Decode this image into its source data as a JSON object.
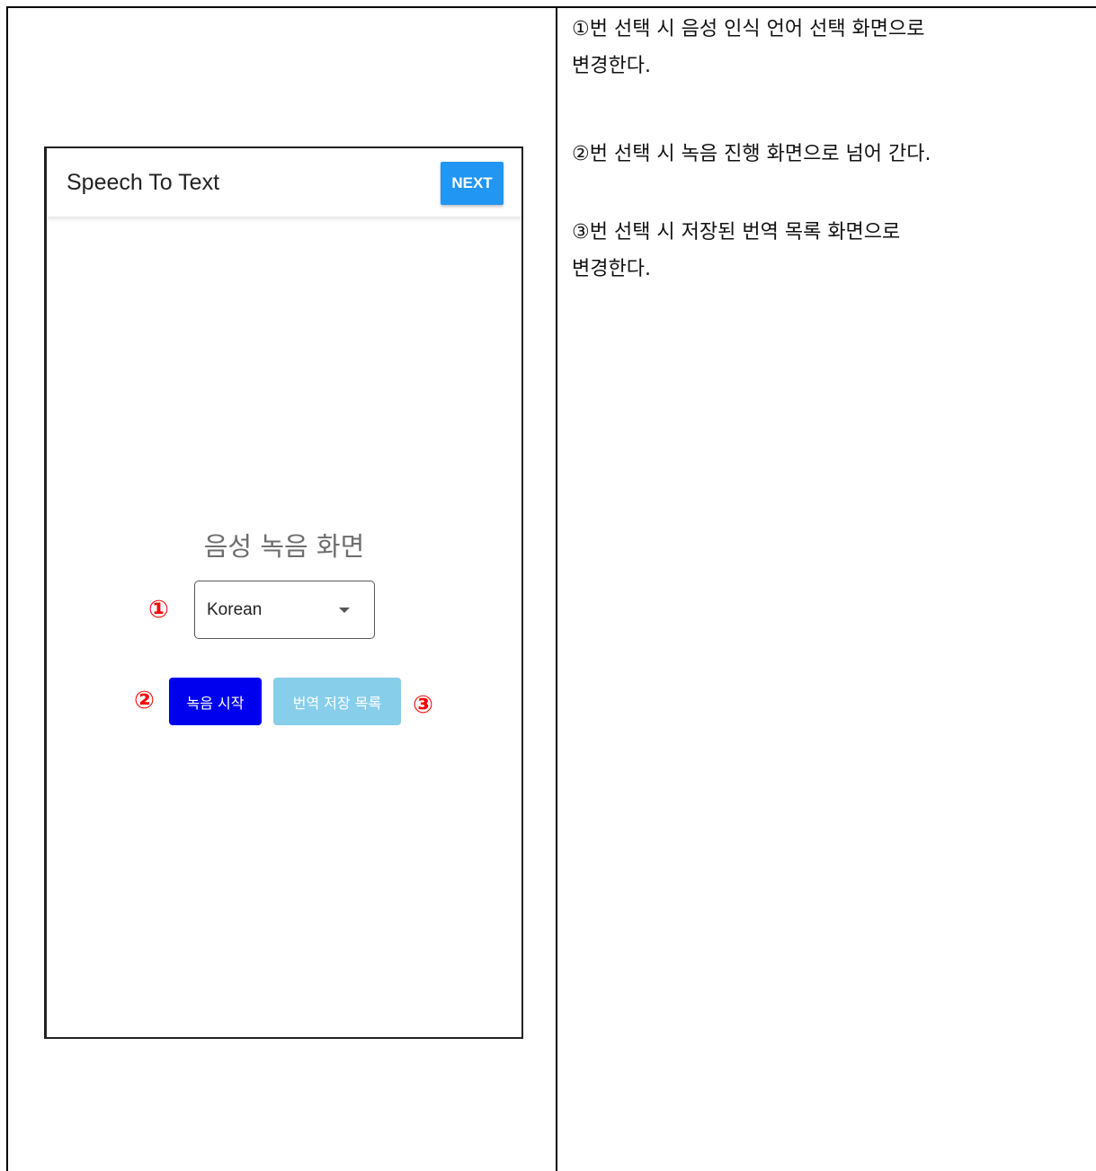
{
  "app": {
    "title": "Speech To Text",
    "next_label": "NEXT",
    "next_color": "#2196f3"
  },
  "screen": {
    "heading": "음성 녹음 화면",
    "language_select": {
      "value": "Korean"
    },
    "record_button_label": "녹음 시작",
    "record_button_color": "#0000ee",
    "saved_list_button_label": "번역 저장 목록",
    "saved_list_button_color": "#87ceeb"
  },
  "markers": [
    "①",
    "②",
    "③"
  ],
  "marker_color": "#ff0000",
  "descriptions": [
    {
      "lines": [
        "①번 선택 시 음성 인식 언어 선택 화면으로",
        "변경한다."
      ]
    },
    {
      "lines": [
        "②번 선택 시 녹음 진행 화면으로 넘어 간다."
      ]
    },
    {
      "lines": [
        "③번 선택 시 저장된 번역 목록 화면으로",
        "변경한다."
      ]
    }
  ]
}
